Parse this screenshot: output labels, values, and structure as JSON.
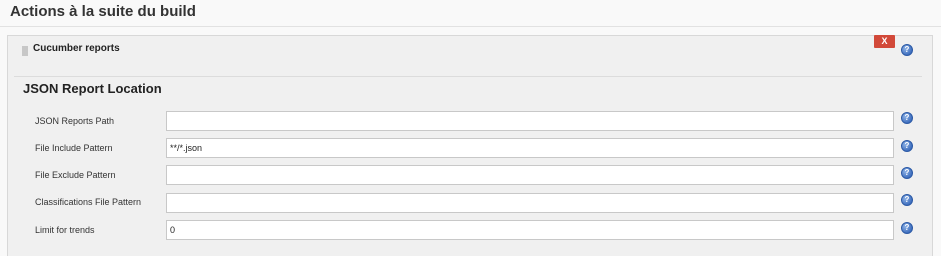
{
  "section": {
    "title": "Actions à la suite du build"
  },
  "step": {
    "name": "Cucumber reports",
    "delete_label": "X",
    "help_glyph": "?"
  },
  "group": {
    "title": "JSON Report Location"
  },
  "fields": [
    {
      "label": "JSON Reports Path",
      "value": ""
    },
    {
      "label": "File Include Pattern",
      "value": "**/*.json"
    },
    {
      "label": "File Exclude Pattern",
      "value": ""
    },
    {
      "label": "Classifications File Pattern",
      "value": ""
    },
    {
      "label": "Limit for trends",
      "value": "0"
    }
  ],
  "colors": {
    "delete_button": "#d24939",
    "help_icon": "#3f6fbf",
    "panel_background": "#f0f0f0"
  }
}
